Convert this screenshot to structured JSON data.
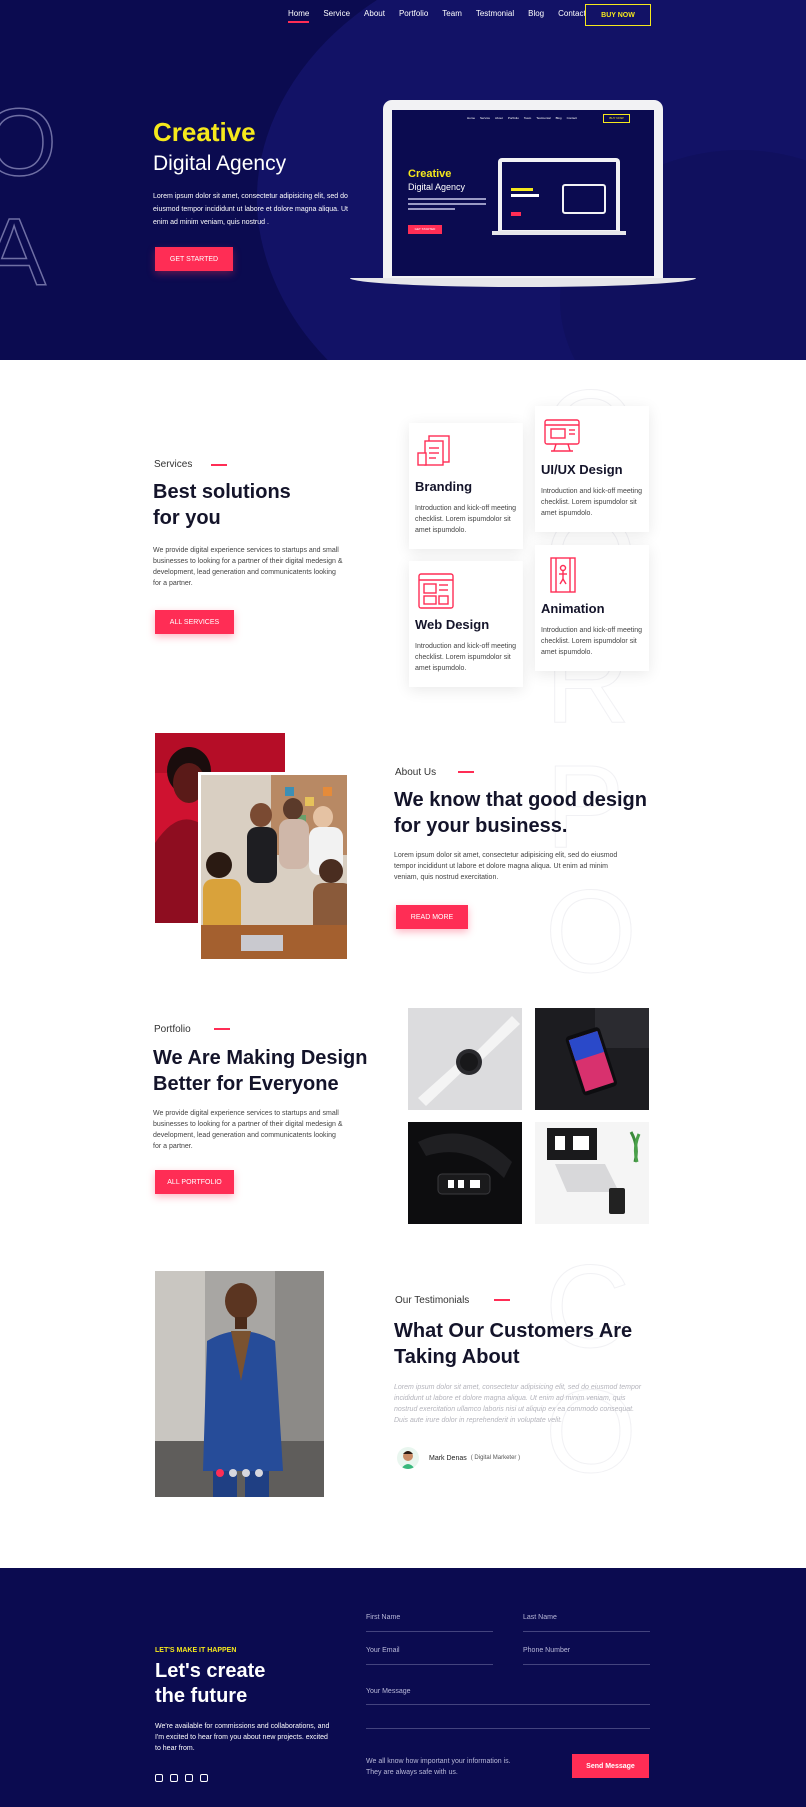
{
  "nav": {
    "items": [
      "Home",
      "Service",
      "About",
      "Portfolio",
      "Team",
      "Testmonial",
      "Blog",
      "Contact"
    ],
    "buy_label": "BUY NOW"
  },
  "hero": {
    "big_letter_1": "O",
    "big_letter_2": "A",
    "title_line1": "Creative",
    "title_line2": "Digital Agency",
    "text": "Lorem ipsum dolor sit amet, consectetur adipisicing elit, sed do eiusmod tempor incididunt ut labore et dolore magna aliqua. Ut enim ad minim veniam, quis nostrud .",
    "button": "GET STARTED",
    "mockup": {
      "nav_items": [
        "Home",
        "Service",
        "About",
        "Portfolio",
        "Team",
        "Testmonial",
        "Blog",
        "Contact"
      ],
      "buy_label": "BUY NOW",
      "title_line1": "Creative",
      "title_line2": "Digital Agency",
      "button": "GET STARTED"
    }
  },
  "services": {
    "label": "Services",
    "title_line1": "Best solutions",
    "title_line2": "for you",
    "text": "We provide digital experience services to startups and small businesses to looking for a partner of their digital medesign & development, lead generation and communicatents looking for a partner.",
    "button": "ALL SERVICES",
    "cards": [
      {
        "title": "Branding",
        "desc": "Introduction and kick-off meeting checklist. Lorem ispumdolor sit amet ispumdolo.",
        "icon": "branding-icon"
      },
      {
        "title": "UI/UX Design",
        "desc": "Introduction and kick-off meeting checklist. Lorem ispumdolor sit amet ispumdolo.",
        "icon": "uiux-icon"
      },
      {
        "title": "Web Design",
        "desc": "Introduction and kick-off meeting checklist. Lorem ispumdolor sit amet ispumdolo.",
        "icon": "web-design-icon"
      },
      {
        "title": "Animation",
        "desc": "Introduction and kick-off meeting checklist. Lorem ispumdolor sit amet ispumdolo.",
        "icon": "animation-icon"
      }
    ]
  },
  "about": {
    "label": "About Us",
    "title_line1": "We know that good design",
    "title_line2": "for your business.",
    "text": "Lorem ipsum dolor sit amet, consectetur adipisicing elit, sed do eiusmod tempor incididunt ut labore et dolore magna aliqua. Ut enim ad minim veniam, quis nostrud exercitation.",
    "button": "READ MORE"
  },
  "portfolio": {
    "label": "Portfolio",
    "title_line1": "We Are Making Design",
    "title_line2": "Better for Everyone",
    "text": "We provide digital experience services to startups and small businesses to looking for a partner of their digital medesign & development, lead generation and communicatents looking for a partner.",
    "button": "ALL PORTFOLIO"
  },
  "testimonials": {
    "label": "Our Testimonials",
    "title_line1": "What Our Customers Are",
    "title_line2": "Taking About",
    "quote": "Lorem ipsum dolor sit amet, consectetur adipisicing elit, sed do eiusmod tempor incididunt ut labore et dolore magna aliqua. Ut enim ad minim veniam, quis nostrud exercitation ullamco laboris nisi ut aliquip ex ea commodo consequat. Duis aute irure dolor in reprehenderit in voluptate velit.",
    "author": "Mark Denas",
    "role": "( Digital Marketer )",
    "active_slide": 1,
    "slide_count": 4
  },
  "ghost_letters": [
    "O",
    "O",
    "R",
    "P",
    "O",
    "R",
    "A",
    "C",
    "O"
  ],
  "footer": {
    "tag": "LET'S MAKE IT HAPPEN",
    "title_line1": "Let's create",
    "title_line2": "the future",
    "text": "We're available for commissions and collaborations, and I'm excited to hear from you about new projects. excited to hear from.",
    "form": {
      "first_name": "First Name",
      "last_name": "Last Name",
      "email": "Your Email",
      "phone": "Phone Number",
      "message": "Your Message",
      "privacy_line1": "We all know how important your information is.",
      "privacy_line2": "They are always safe with us.",
      "send": "Send Message"
    },
    "social": [
      "facebook-icon",
      "twitter-icon",
      "linkedin-icon",
      "instagram-icon"
    ]
  },
  "colors": {
    "navy": "#0b0b50",
    "accent_red": "#ff2d55",
    "accent_yellow": "#f5e81c"
  }
}
